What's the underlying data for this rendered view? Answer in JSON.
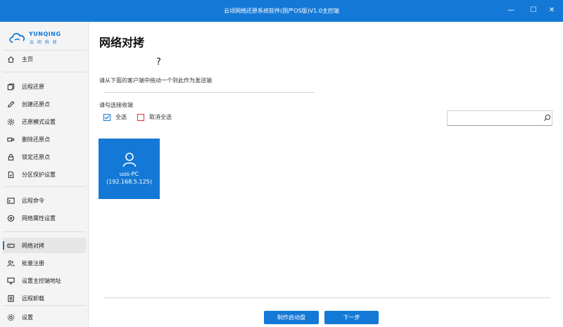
{
  "window": {
    "title": "云顷网络还原系统软件(国产OS版)V1.0主控端",
    "minimize": "—",
    "maximize": "☐",
    "close": "✕"
  },
  "logo": {
    "text": "YUNQING",
    "sub": "云 顷 科 技"
  },
  "sidebar": {
    "home": "主页",
    "remote_restore": "远程还原",
    "create_restore_point": "创建还原点",
    "restore_mode": "还原模式设置",
    "delete_restore_point": "删除还原点",
    "lock_restore_point": "锁定还原点",
    "partition_protect": "分区保护设置",
    "remote_command": "远程命令",
    "network_props": "网络属性设置",
    "network_copy": "网络对拷",
    "batch_register": "批量注册",
    "set_master_addr": "设置主控端地址",
    "remote_uninstall": "远程卸载",
    "settings": "设置"
  },
  "main": {
    "title": "网络对拷",
    "question_mark": "?",
    "instruction": "请从下面的客户端中拖动一个到此作为发送端",
    "select_label": "请勾选接收端",
    "select_all": "全选",
    "deselect_all": "取消全选",
    "search_placeholder": ""
  },
  "clients": [
    {
      "name": "uos-PC",
      "ip": "(192.168.5.125)"
    }
  ],
  "buttons": {
    "make_boot_disk": "制作启动盘",
    "next": "下一步"
  },
  "colors": {
    "accent": "#1479d6",
    "deselect_border": "#d9363e"
  }
}
